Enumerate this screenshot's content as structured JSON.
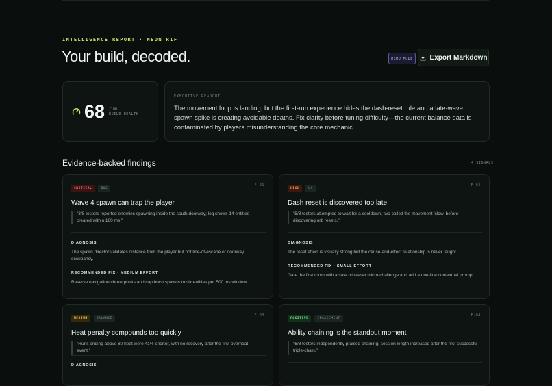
{
  "header": {
    "eyebrow": "INTELLIGENCE REPORT · NEON RIFT",
    "title": "Your build, decoded.",
    "demo_badge": "DEMO MODE",
    "export_label": "Export Markdown"
  },
  "score": {
    "value": "68",
    "max": "/100",
    "label": "BUILD HEALTH"
  },
  "readout": {
    "label": "EXECUTIVE READOUT",
    "text": "The movement loop is landing, but the first-run experience hides the dash-reset rule and a late-wave spawn spike is creating avoidable deaths. Fix clarity before tuning difficulty—the current balance data is contaminated by players misunderstanding the core mechanic."
  },
  "findings_section": {
    "title": "Evidence-backed findings",
    "count": "4 SIGNALS",
    "diagnosis_label": "DIAGNOSIS"
  },
  "findings": [
    {
      "id": "F-01",
      "severity": "CRITICAL",
      "category": "BUG",
      "title": "Wave 4 spawn can trap the player",
      "quote": "\"3/8 testers reported enemies spawning inside the south doorway; log shows 14 entities created within 180 ms.\"",
      "diagnosis": "The spawn director validates distance from the player but not line-of-escape or doorway occupancy.",
      "fix_label": "RECOMMENDED FIX · MEDIUM EFFORT",
      "fix": "Reserve navigation choke points and cap burst spawns to six entities per 500 ms window."
    },
    {
      "id": "F-02",
      "severity": "HIGH",
      "category": "UX",
      "title": "Dash reset is discovered too late",
      "quote": "\"5/8 testers attempted to wait for a cooldown; two called the movement 'slow' before discovering orb resets.\"",
      "diagnosis": "The reset effect is visually strong but the cause-and-effect relationship is never taught.",
      "fix_label": "RECOMMENDED FIX · SMALL EFFORT",
      "fix": "Gate the first room with a safe orb-reset micro-challenge and add a one-line contextual prompt."
    },
    {
      "id": "F-03",
      "severity": "MEDIUM",
      "category": "BALANCE",
      "title": "Heat penalty compounds too quickly",
      "quote": "\"Runs ending above 80 heat were 41% shorter, with no recovery after the first overheat event.\"",
      "diagnosis": "",
      "fix_label": "",
      "fix": ""
    },
    {
      "id": "F-04",
      "severity": "POSITIVE",
      "category": "ENGAGEMENT",
      "title": "Ability chaining is the standout moment",
      "quote": "\"6/8 testers independently praised chaining; session length increased after the first successful triple-chain.\"",
      "diagnosis": "",
      "fix_label": "",
      "fix": ""
    }
  ],
  "colors": {
    "accent": "#c5e86c",
    "critical": "#ff7a6b",
    "high": "#ff9a5c",
    "medium": "#e8c35c",
    "positive": "#7ee08c"
  }
}
